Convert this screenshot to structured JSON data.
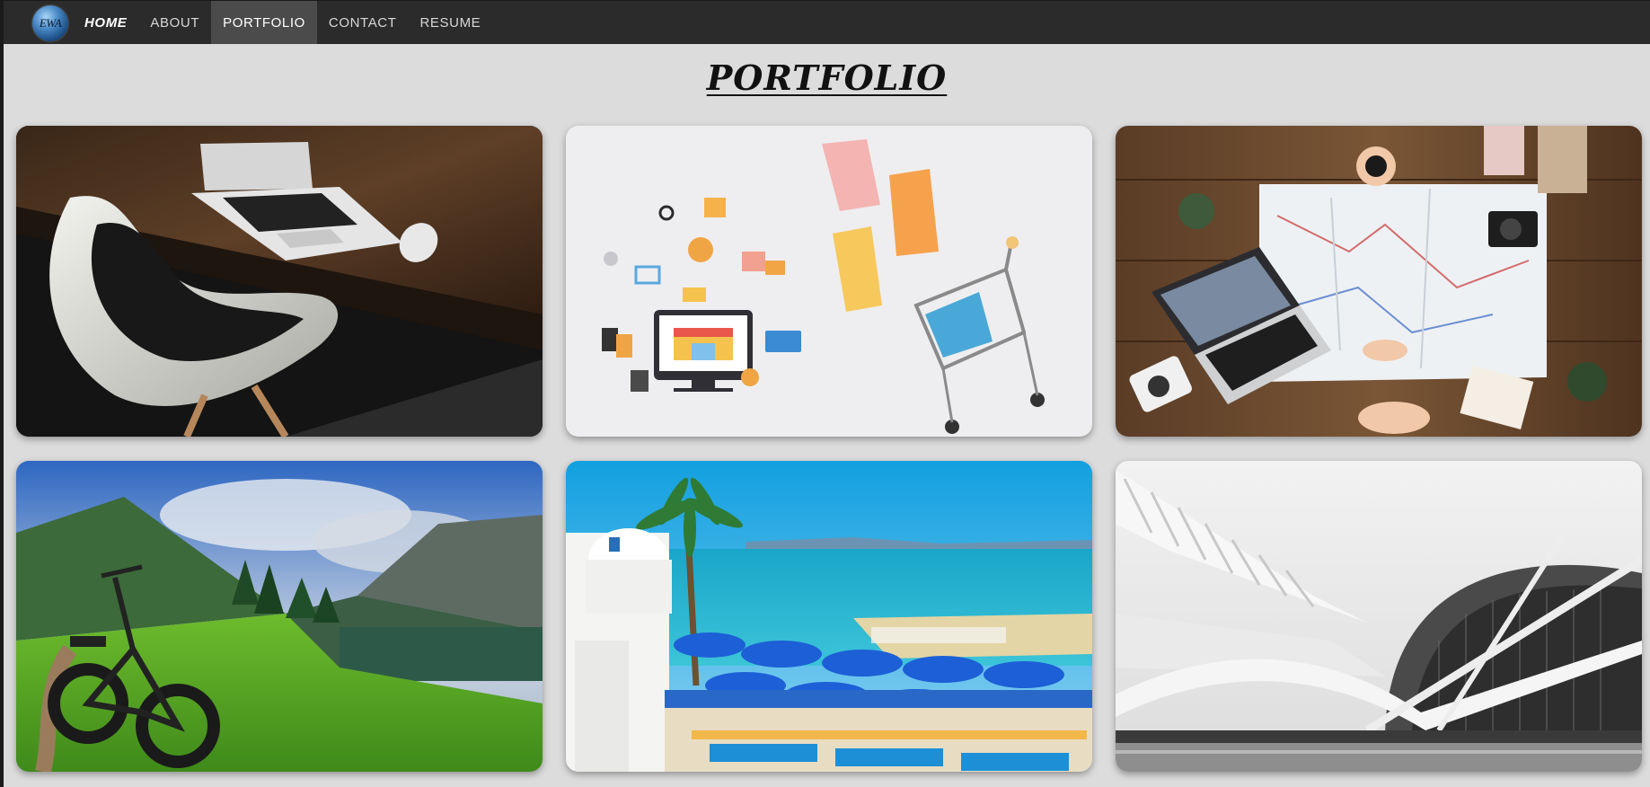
{
  "nav": {
    "logo_text": "EWA",
    "items": [
      {
        "label": "HOME"
      },
      {
        "label": "ABOUT"
      },
      {
        "label": "PORTFOLIO"
      },
      {
        "label": "CONTACT"
      },
      {
        "label": "RESUME"
      }
    ],
    "active": "PORTFOLIO"
  },
  "page": {
    "title": "PORTFOLIO"
  },
  "gallery": {
    "items": [
      {
        "icon": "workspace-laptop-chair-image"
      },
      {
        "icon": "ecommerce-shopping-image"
      },
      {
        "icon": "travel-map-laptop-image"
      },
      {
        "icon": "mountain-ebike-landscape-image"
      },
      {
        "icon": "seaside-village-image"
      },
      {
        "icon": "modern-architecture-image"
      }
    ]
  },
  "colors": {
    "navbar_bg": "#2b2b2b",
    "active_nav_bg": "#4b4b4b",
    "page_bg": "#dcdcdc"
  }
}
